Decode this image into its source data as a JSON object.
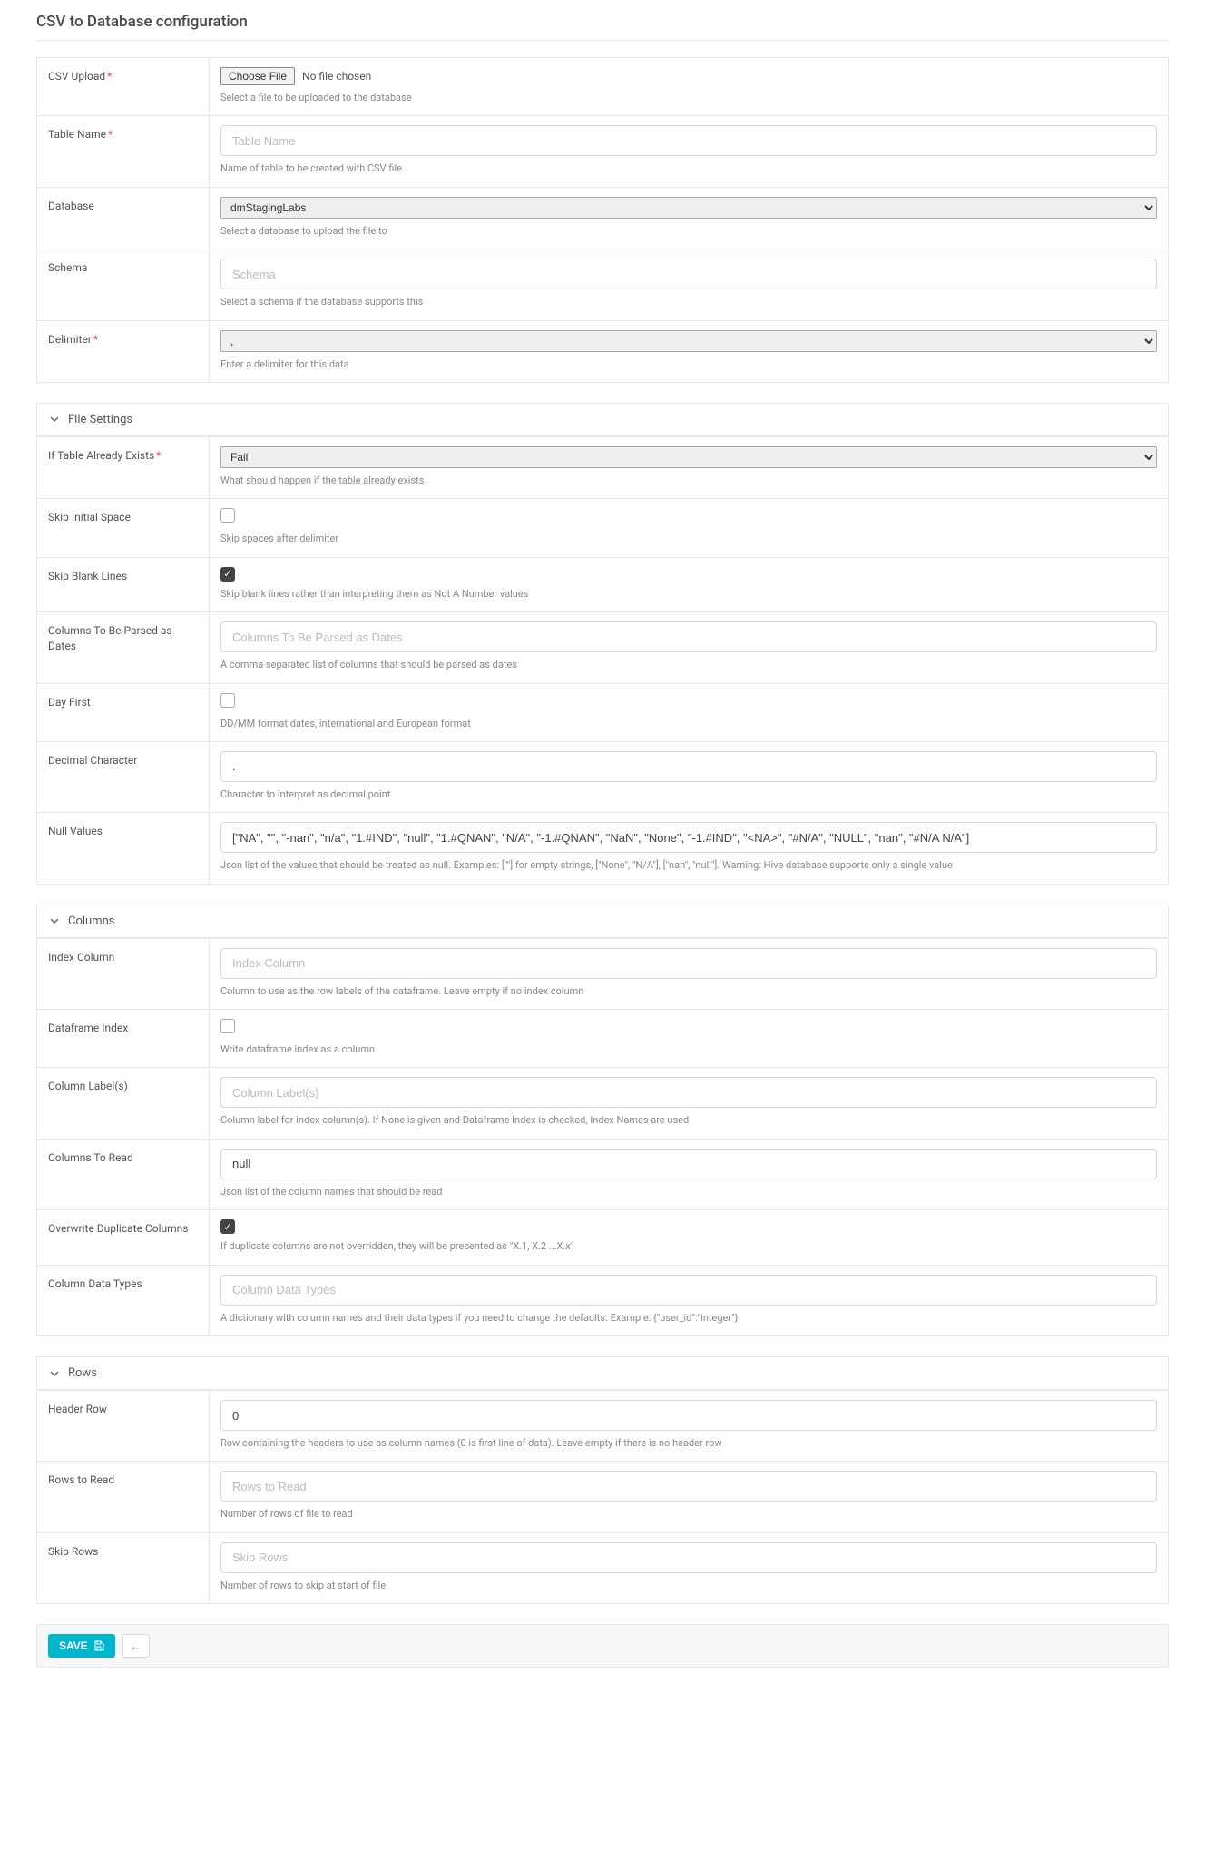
{
  "page": {
    "title": "CSV to Database configuration"
  },
  "sections": {
    "file_settings": "File Settings",
    "columns": "Columns",
    "rows": "Rows"
  },
  "fields": {
    "csv_upload": {
      "label": "CSV Upload",
      "choose_btn": "Choose File",
      "status": "No file chosen",
      "help": "Select a file to be uploaded to the database"
    },
    "table_name": {
      "label": "Table Name",
      "placeholder": "Table Name",
      "help": "Name of table to be created with CSV file"
    },
    "database": {
      "label": "Database",
      "value": "dmStagingLabs",
      "help": "Select a database to upload the file to"
    },
    "schema": {
      "label": "Schema",
      "placeholder": "Schema",
      "help": "Select a schema if the database supports this"
    },
    "delimiter": {
      "label": "Delimiter",
      "value": ",",
      "help": "Enter a delimiter for this data"
    },
    "if_exists": {
      "label": "If Table Already Exists",
      "value": "Fail",
      "help": "What should happen if the table already exists"
    },
    "skip_initial_space": {
      "label": "Skip Initial Space",
      "help": "Skip spaces after delimiter"
    },
    "skip_blank_lines": {
      "label": "Skip Blank Lines",
      "help": "Skip blank lines rather than interpreting them as Not A Number values"
    },
    "parse_dates": {
      "label": "Columns To Be Parsed as Dates",
      "placeholder": "Columns To Be Parsed as Dates",
      "help": "A comma separated list of columns that should be parsed as dates"
    },
    "day_first": {
      "label": "Day First",
      "help": "DD/MM format dates, international and European format"
    },
    "decimal": {
      "label": "Decimal Character",
      "value": ".",
      "help": "Character to interpret as decimal point"
    },
    "null_values": {
      "label": "Null Values",
      "value": "[\"NA\", \"\", \"-nan\", \"n/a\", \"1.#IND\", \"null\", \"1.#QNAN\", \"N/A\", \"-1.#QNAN\", \"NaN\", \"None\", \"-1.#IND\", \"<NA>\", \"#N/A\", \"NULL\", \"nan\", \"#N/A N/A\"]",
      "help": "Json list of the values that should be treated as null. Examples: [\"\"] for empty strings, [\"None\", \"N/A\"], [\"nan\", \"null\"]. Warning: Hive database supports only a single value"
    },
    "index_col": {
      "label": "Index Column",
      "placeholder": "Index Column",
      "help": "Column to use as the row labels of the dataframe. Leave empty if no index column"
    },
    "dataframe_index": {
      "label": "Dataframe Index",
      "help": "Write dataframe index as a column"
    },
    "column_labels": {
      "label": "Column Label(s)",
      "placeholder": "Column Label(s)",
      "help": "Column label for index column(s). If None is given and Dataframe Index is checked, Index Names are used"
    },
    "columns_to_read": {
      "label": "Columns To Read",
      "value": "null",
      "help": "Json list of the column names that should be read"
    },
    "overwrite_dup": {
      "label": "Overwrite Duplicate Columns",
      "help": "If duplicate columns are not overridden, they will be presented as \"X.1, X.2 ...X.x\""
    },
    "column_dtypes": {
      "label": "Column Data Types",
      "placeholder": "Column Data Types",
      "help": "A dictionary with column names and their data types if you need to change the defaults. Example: {\"user_id\":\"integer\"}"
    },
    "header_row": {
      "label": "Header Row",
      "value": "0",
      "help": "Row containing the headers to use as column names (0 is first line of data). Leave empty if there is no header row"
    },
    "rows_to_read": {
      "label": "Rows to Read",
      "placeholder": "Rows to Read",
      "help": "Number of rows of file to read"
    },
    "skip_rows": {
      "label": "Skip Rows",
      "placeholder": "Skip Rows",
      "help": "Number of rows to skip at start of file"
    }
  },
  "footer": {
    "save": "SAVE"
  }
}
